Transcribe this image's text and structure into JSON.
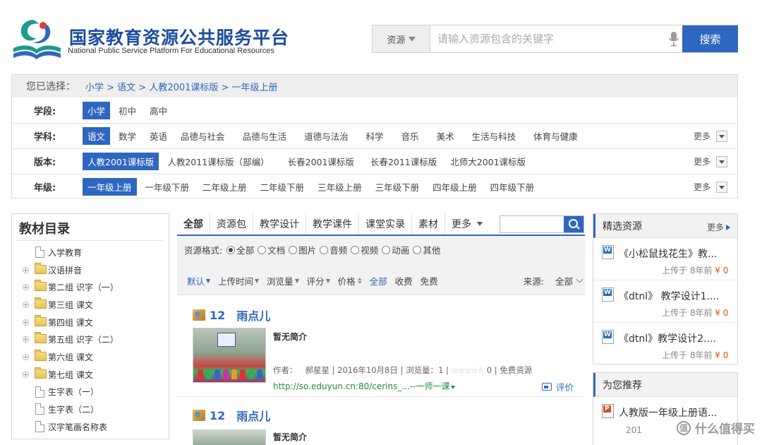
{
  "header": {
    "logo_cn": "国家教育资源公共服务平台",
    "logo_en": "National Public  Service Platform For Educational Resources",
    "search_type": "资源",
    "search_placeholder": "请输入资源包含的关键字",
    "search_button": "搜索"
  },
  "filter": {
    "selected_label": "您已选择：",
    "selected_path": "小学 > 语文 > 人教2001课标版 > 一年级上册",
    "more_label": "更多",
    "rows": [
      {
        "label": "学段:",
        "options": [
          "小学",
          "初中",
          "高中"
        ],
        "selected": 0
      },
      {
        "label": "学科:",
        "options": [
          "语文",
          "数学",
          "英语",
          "品德与社会",
          "品德与生活",
          "道德与法治",
          "科学",
          "音乐",
          "美术",
          "生活与科技",
          "体育与健康"
        ],
        "selected": 0
      },
      {
        "label": "版本:",
        "options": [
          "人教2001课标版",
          "人教2011课标版（部编）",
          "长春2001课标版",
          "长春2011课标版",
          "北师大2001课标版"
        ],
        "selected": 0
      },
      {
        "label": "年级:",
        "options": [
          "一年级上册",
          "一年级下册",
          "二年级上册",
          "二年级下册",
          "三年级上册",
          "三年级下册",
          "四年级上册",
          "四年级下册"
        ],
        "selected": 0
      }
    ]
  },
  "tree": {
    "title": "教材目录",
    "items": [
      {
        "label": "入学教育",
        "type": "file"
      },
      {
        "label": "汉语拼音",
        "type": "folder"
      },
      {
        "label": "第二组 识字（一）",
        "type": "folder"
      },
      {
        "label": "第三组 课文",
        "type": "folder"
      },
      {
        "label": "第四组 课文",
        "type": "folder"
      },
      {
        "label": "第五组 识字（二）",
        "type": "folder"
      },
      {
        "label": "第六组 课文",
        "type": "folder"
      },
      {
        "label": "第七组 课文",
        "type": "folder"
      },
      {
        "label": "生字表（一）",
        "type": "file"
      },
      {
        "label": "生字表（二）",
        "type": "file"
      },
      {
        "label": "汉字笔画名称表",
        "type": "file"
      }
    ]
  },
  "tabs": {
    "items": [
      "全部",
      "资源包",
      "教学设计",
      "教学课件",
      "课堂实录",
      "素材"
    ],
    "more": "更多",
    "selected": 0
  },
  "format": {
    "label": "资源格式:",
    "options": [
      "全部",
      "文档",
      "图片",
      "音频",
      "视频",
      "动画",
      "其他"
    ],
    "selected": 0
  },
  "sort": {
    "default": "默认",
    "upload_time": "上传时间",
    "views": "浏览量",
    "rating": "评分",
    "price": "价格",
    "all": "全部",
    "paid": "收费",
    "free": "免费",
    "source_label": "来源:",
    "source_value": "全部"
  },
  "results": [
    {
      "num": "12",
      "title": "雨点儿",
      "brief": "暂无简介",
      "meta_author_label": "作者：",
      "author": "郝星星",
      "date": "2016年10月8日",
      "views_label": "浏览量：",
      "views": "1",
      "stars": "☆☆☆☆☆",
      "score": "0",
      "price_text": "免费资源",
      "link": "http://so.eduyun.cn:80/cerins_...",
      "link_suffix": "--一师一课",
      "review": "评价"
    },
    {
      "num": "12",
      "title": "雨点儿",
      "brief": "暂无简介"
    }
  ],
  "featured": {
    "title": "精选资源",
    "more": "更多",
    "items": [
      {
        "title": "《小松鼠找花生》教...",
        "uploaded": "上传于 8年前",
        "price": "¥ 0"
      },
      {
        "title": "《dtnl》 教学设计1....",
        "uploaded": "上传于 8年前",
        "price": "¥ 0"
      },
      {
        "title": "《dtnl》教学设计2....",
        "uploaded": "上传于 8年前",
        "price": "¥ 0"
      }
    ]
  },
  "recommend": {
    "title": "为您推荐",
    "items": [
      {
        "title": "人教版一年级上册语...",
        "sub": "201"
      }
    ]
  },
  "watermark": {
    "icon": "值",
    "text": "什么值得买"
  },
  "colors": {
    "accent": "#2f67c0",
    "brand_text": "#1b4d9c",
    "link_green": "#2a8a3a",
    "price_orange": "#e05a00"
  }
}
